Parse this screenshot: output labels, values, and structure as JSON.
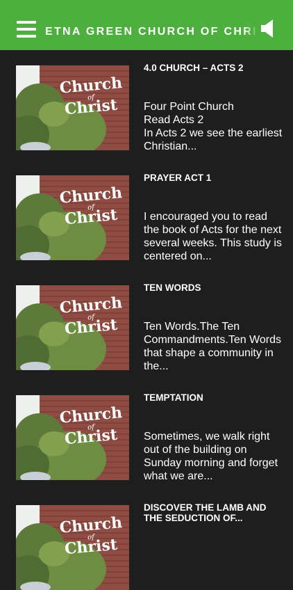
{
  "header": {
    "title": "ETNA GREEN CHURCH OF CHRIST",
    "menu_icon": "hamburger-menu-icon",
    "speaker_icon": "speaker-icon",
    "bar_color": "#4caf3e"
  },
  "thumbnail": {
    "line1": "Church",
    "line2": "of",
    "line3": "Christ"
  },
  "items": [
    {
      "title": "4.0 CHURCH – ACTS 2",
      "description": "Four Point Church\nRead Acts 2\nIn Acts 2 we see the earliest Christian..."
    },
    {
      "title": "PRAYER ACT 1",
      "description": "I encouraged you to read the book of Acts for the next several weeks. This study is centered on..."
    },
    {
      "title": "TEN WORDS",
      "description": "Ten Words.The Ten Commandments.Ten Words that shape a community in the..."
    },
    {
      "title": "TEMPTATION",
      "description": "Sometimes, we walk right out of the building on Sunday morning and forget what we are..."
    },
    {
      "title": "DISCOVER THE LAMB AND THE SEDUCTION OF...",
      "description": ""
    }
  ]
}
